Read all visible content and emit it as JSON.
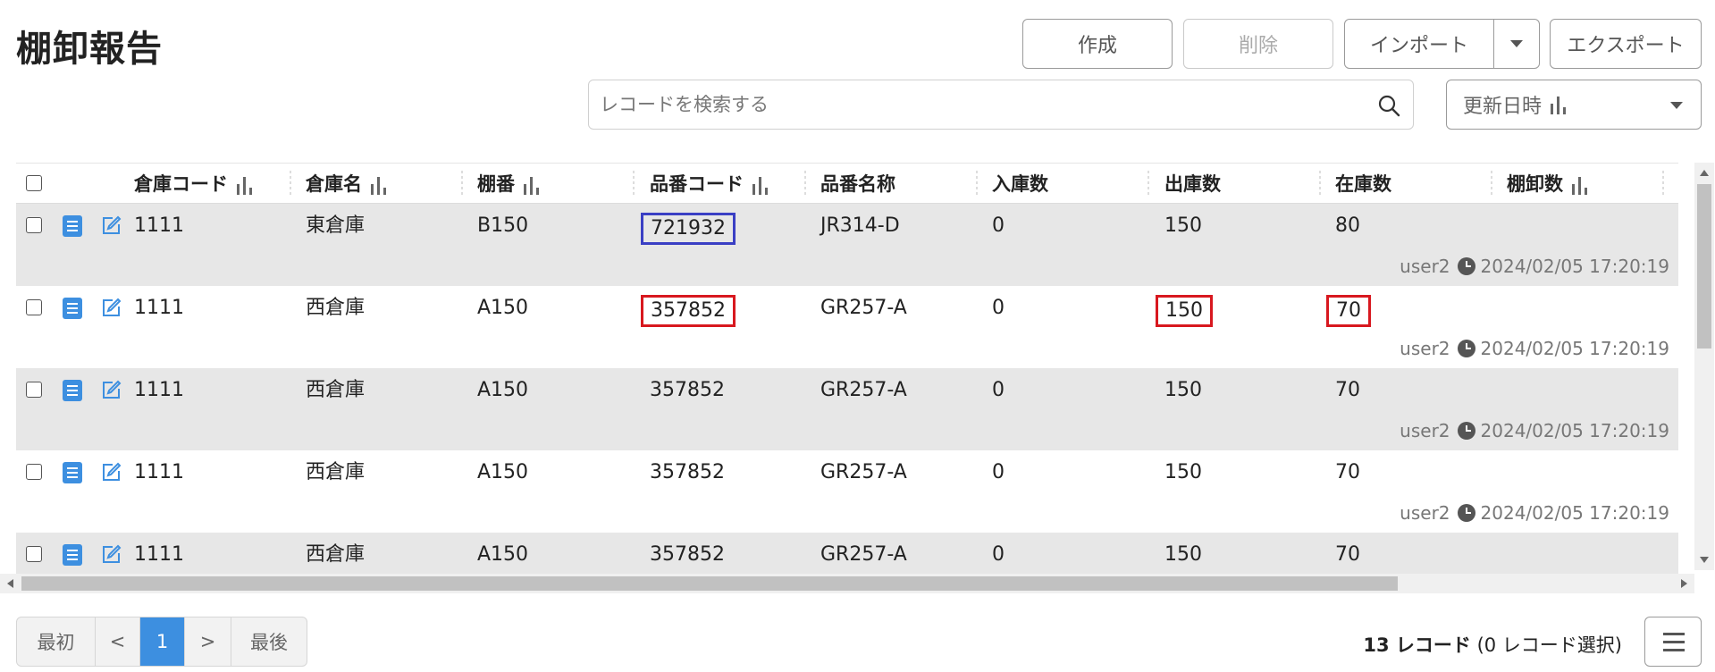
{
  "header": {
    "title": "棚卸報告"
  },
  "toolbar": {
    "create_label": "作成",
    "delete_label": "削除",
    "import_label": "インポート",
    "export_label": "エクスポート"
  },
  "search": {
    "placeholder": "レコードを検索する",
    "value": ""
  },
  "sort": {
    "label": "更新日時"
  },
  "table": {
    "columns": [
      "倉庫コード",
      "倉庫名",
      "棚番",
      "品番コード",
      "品番名称",
      "入庫数",
      "出庫数",
      "在庫数",
      "棚卸数"
    ],
    "rows": [
      {
        "warehouse_code": "1111",
        "warehouse_name": "東倉庫",
        "shelf": "B150",
        "part_code": "721932",
        "part_name": "JR314-D",
        "in_qty": "0",
        "out_qty": "150",
        "stock_qty": "80",
        "count_qty": "",
        "user": "user2",
        "updated": "2024/02/05 17:20:19"
      },
      {
        "warehouse_code": "1111",
        "warehouse_name": "西倉庫",
        "shelf": "A150",
        "part_code": "357852",
        "part_name": "GR257-A",
        "in_qty": "0",
        "out_qty": "150",
        "stock_qty": "70",
        "count_qty": "",
        "user": "user2",
        "updated": "2024/02/05 17:20:19"
      },
      {
        "warehouse_code": "1111",
        "warehouse_name": "西倉庫",
        "shelf": "A150",
        "part_code": "357852",
        "part_name": "GR257-A",
        "in_qty": "0",
        "out_qty": "150",
        "stock_qty": "70",
        "count_qty": "",
        "user": "user2",
        "updated": "2024/02/05 17:20:19"
      },
      {
        "warehouse_code": "1111",
        "warehouse_name": "西倉庫",
        "shelf": "A150",
        "part_code": "357852",
        "part_name": "GR257-A",
        "in_qty": "0",
        "out_qty": "150",
        "stock_qty": "70",
        "count_qty": "",
        "user": "user2",
        "updated": "2024/02/05 17:20:19"
      },
      {
        "warehouse_code": "1111",
        "warehouse_name": "西倉庫",
        "shelf": "A150",
        "part_code": "357852",
        "part_name": "GR257-A",
        "in_qty": "0",
        "out_qty": "150",
        "stock_qty": "70",
        "count_qty": "",
        "user": "",
        "updated": ""
      }
    ]
  },
  "pagination": {
    "first": "最初",
    "prev": "<",
    "current": "1",
    "next": ">",
    "last": "最後"
  },
  "footer": {
    "record_count": "13 レコード",
    "selected": "(0 レコード選択)"
  },
  "colors": {
    "accent": "#3d8fe0",
    "highlight_red": "#d8181f",
    "highlight_blue": "#3a3fc4",
    "row_grey": "#e7e7e7"
  }
}
